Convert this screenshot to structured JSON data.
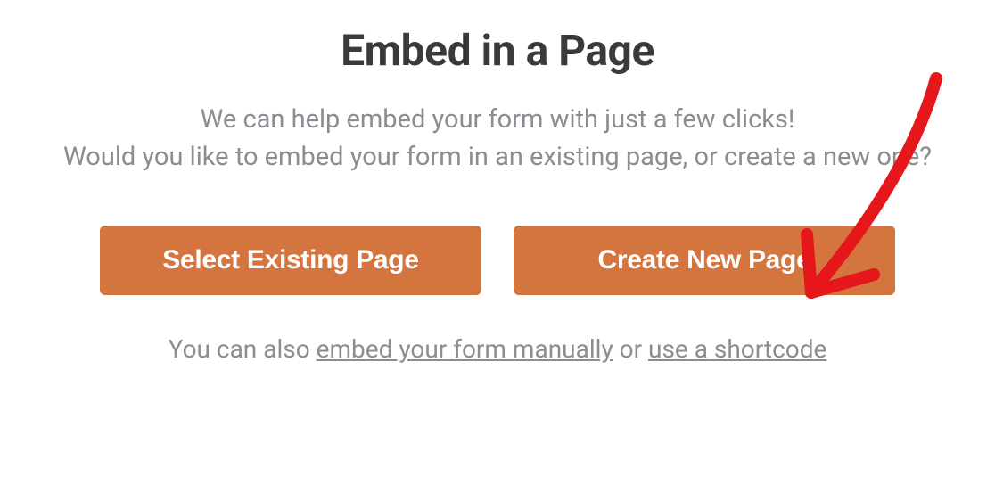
{
  "modal": {
    "title": "Embed in a Page",
    "description_line1": "We can help embed your form with just a few clicks!",
    "description_line2": "Would you like to embed your form in an existing page, or create a new one?",
    "buttons": {
      "select_existing": "Select Existing Page",
      "create_new": "Create New Page"
    },
    "footer": {
      "prefix": "You can also ",
      "link_manual": "embed your form manually",
      "middle": " or ",
      "link_shortcode": "use a shortcode"
    }
  },
  "colors": {
    "button_bg": "#d4743f",
    "text_dark": "#3a3a3a",
    "text_muted": "#8a8d91",
    "annotation": "#e6171a"
  },
  "annotation": {
    "type": "arrow",
    "points_to": "create-new-page-button"
  }
}
